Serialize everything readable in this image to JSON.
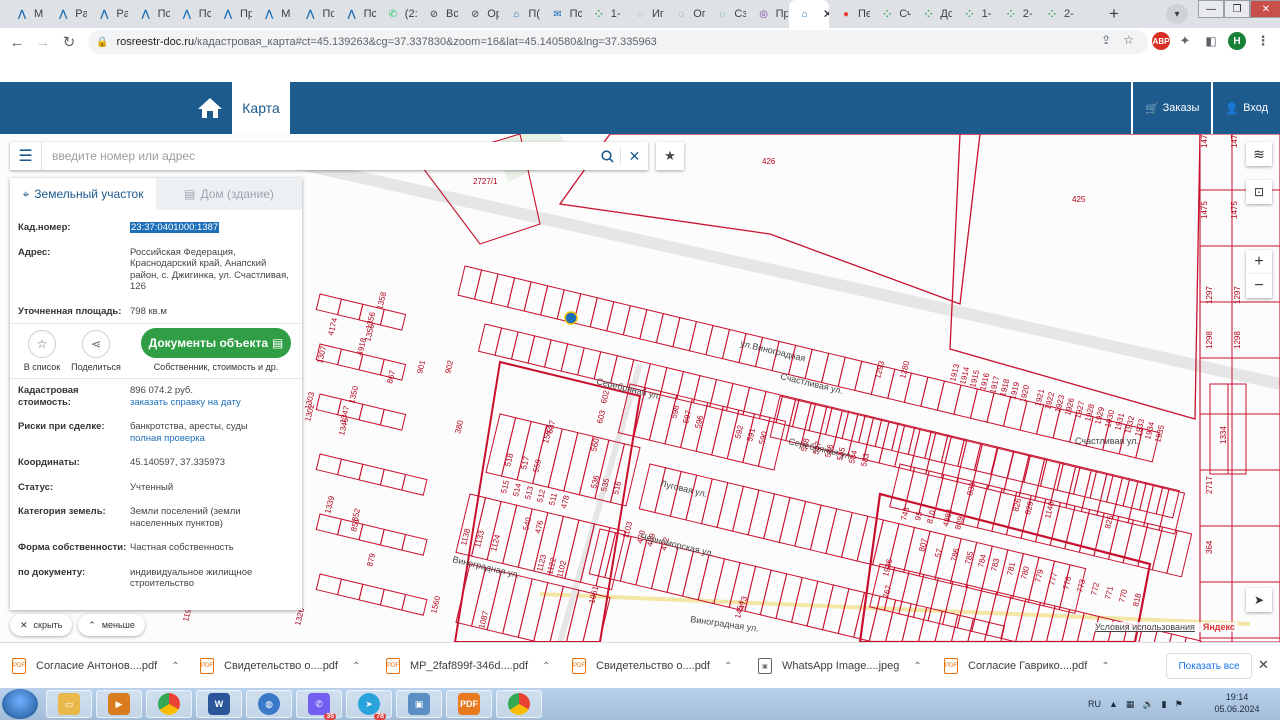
{
  "browser": {
    "tabs": [
      {
        "title": "M",
        "icon": "rr-logo-icon",
        "color": "#1d6fb8",
        "glyph": "⋀"
      },
      {
        "title": "Pa",
        "icon": "rr-logo-icon",
        "color": "#1d6fb8",
        "glyph": "⋀"
      },
      {
        "title": "Pa",
        "icon": "rr-logo-icon",
        "color": "#1d6fb8",
        "glyph": "⋀"
      },
      {
        "title": "Пс",
        "icon": "rr-logo-icon",
        "color": "#1d6fb8",
        "glyph": "⋀"
      },
      {
        "title": "Пс",
        "icon": "rr-logo-icon",
        "color": "#1d6fb8",
        "glyph": "⋀"
      },
      {
        "title": "Пр",
        "icon": "rr-logo-icon",
        "color": "#1d6fb8",
        "glyph": "⋀"
      },
      {
        "title": "M",
        "icon": "rr-logo-icon",
        "color": "#1d6fb8",
        "glyph": "⋀"
      },
      {
        "title": "Пс",
        "icon": "rr-logo-icon",
        "color": "#1d6fb8",
        "glyph": "⋀"
      },
      {
        "title": "Пс",
        "icon": "rr-logo-icon",
        "color": "#1d6fb8",
        "glyph": "⋀"
      },
      {
        "title": "(2:",
        "icon": "whatsapp-icon",
        "color": "#25d366",
        "glyph": "✆"
      },
      {
        "title": "Вс",
        "icon": "globe-icon",
        "color": "#5f6368",
        "glyph": "⊘"
      },
      {
        "title": "Ор",
        "icon": "globe-icon",
        "color": "#5f6368",
        "glyph": "⊘"
      },
      {
        "title": "П(",
        "icon": "home-icon",
        "color": "#1d6fb8",
        "glyph": "⌂"
      },
      {
        "title": "Пс",
        "icon": "mail-icon",
        "color": "#1d6fb8",
        "glyph": "✉"
      },
      {
        "title": "1-",
        "icon": "dots-icon",
        "color": "#34a853",
        "glyph": "⁘"
      },
      {
        "title": "Иг",
        "icon": "refresh-icon",
        "color": "#34a853",
        "glyph": "◌"
      },
      {
        "title": "Ог",
        "icon": "refresh-icon",
        "color": "#34a853",
        "glyph": "◌"
      },
      {
        "title": "Сз",
        "icon": "refresh-icon",
        "color": "#34a853",
        "glyph": "◌"
      },
      {
        "title": "Пр",
        "icon": "emblem-icon",
        "color": "#7b3fa0",
        "glyph": "◎"
      },
      {
        "title": "",
        "icon": "home-icon",
        "color": "#1d6fb8",
        "glyph": "⌂",
        "active": true
      },
      {
        "title": "Пє",
        "icon": "map-pin-icon",
        "color": "#ea4335",
        "glyph": "●"
      },
      {
        "title": "Сч",
        "icon": "dots-icon",
        "color": "#34a853",
        "glyph": "⁘"
      },
      {
        "title": "Дс",
        "icon": "dots-icon",
        "color": "#34a853",
        "glyph": "⁘"
      },
      {
        "title": "1-",
        "icon": "dots-icon",
        "color": "#34a853",
        "glyph": "⁘"
      },
      {
        "title": "2-",
        "icon": "dots-icon",
        "color": "#34a853",
        "glyph": "⁘"
      },
      {
        "title": "2-",
        "icon": "dots-icon",
        "color": "#34a853",
        "glyph": "⁘"
      }
    ],
    "url_host": "rosreestr-doc.ru",
    "url_path": "/кадастровая_карта#ct=45.139263&cg=37.337830&zoom=16&lat=45.140580&lng=37.335963",
    "profile_initial": "H",
    "abp_label": "ABP"
  },
  "site": {
    "nav_map": "Карта",
    "orders": "Заказы",
    "login": "Вход",
    "search_placeholder": "введите номер или адрес"
  },
  "panel": {
    "tab_land": "Земельный участок",
    "tab_house": "Дом (здание)",
    "kad_label": "Кад.номер:",
    "kad_value": "23:37:0401000:1387",
    "addr_label": "Адрес:",
    "addr_value": "Российская Федерация, Краснодарский край, Анапский район, с. Джигинка, ул. Счастливая, 126",
    "area_label": "Уточненная площадь:",
    "area_value": "798 кв.м",
    "act_list": "В список",
    "act_share": "Поделиться",
    "doc_button": "Документы объекта",
    "doc_sub": "Собственник, стоимость и др.",
    "cost_label": "Кадастровая стоимость:",
    "cost_value": "896 074.2 руб.",
    "cost_link": "заказать справку на дату",
    "risk_label": "Риски при сделке:",
    "risk_value": "банкротства, аресты, суды",
    "risk_link": "полная проверка",
    "coord_label": "Координаты:",
    "coord_value": "45.140597, 37.335973",
    "status_label": "Статус:",
    "status_value": "Учтенный",
    "cat_label": "Категория земель:",
    "cat_value": "Земли поселений (земли населенных пунктов)",
    "own_label": "Форма собственности:",
    "own_value": "Частная собственность",
    "doc_label": "по документу:",
    "doc_value": "индивидуальное жилищное строительство",
    "hide": "скрыть",
    "less": "меньше"
  },
  "map": {
    "attribution": "Условия использования",
    "yandex": "Яндекс",
    "streets": [
      "ул.Виноградная",
      "Счастливая ул.",
      "Серебряная ул.",
      "Серебряная ул.",
      "Счастливая ул.",
      "Виноградная ул.",
      "Виноградная ул.",
      "Черноморская ул.",
      "Луговая ул."
    ],
    "labels": [
      "426",
      "425",
      "2727/1",
      "1474",
      "1474",
      "1475",
      "1475",
      "1297",
      "1297",
      "1298",
      "1298",
      "1334",
      "2717",
      "364",
      "1358",
      "1356",
      "1355",
      "4174",
      "4918",
      "1307",
      "867",
      "1303",
      "1302",
      "1350",
      "1347",
      "1346",
      "901",
      "902",
      "380",
      "1293",
      "1280",
      "1339",
      "852",
      "851",
      "879",
      "1195",
      "1326",
      "603",
      "602",
      "598",
      "597",
      "596",
      "592",
      "591",
      "590",
      "588",
      "587",
      "586",
      "585",
      "584",
      "583",
      "1913",
      "1914",
      "1915",
      "1916",
      "1917",
      "1918",
      "1919",
      "1920",
      "1921",
      "1922",
      "1923",
      "1926",
      "1927",
      "1928",
      "1929",
      "1930",
      "1931",
      "1932",
      "1933",
      "1934",
      "1935",
      "1936",
      "767",
      "743",
      "95",
      "810",
      "4884",
      "809",
      "807",
      "57",
      "786",
      "785",
      "784",
      "783",
      "781",
      "780",
      "779",
      "777",
      "776",
      "773",
      "772",
      "771",
      "770",
      "818",
      "825",
      "826",
      "829",
      "833",
      "1140",
      "1138",
      "1133",
      "1124",
      "1123",
      "1122",
      "1102",
      "1103",
      "470",
      "469",
      "472",
      "473",
      "1061",
      "1087",
      "1454",
      "1560",
      "1562",
      "537",
      "536",
      "535",
      "516",
      "515",
      "514",
      "513",
      "512",
      "511",
      "478",
      "476",
      "540",
      "518",
      "517",
      "559",
      "560"
    ]
  },
  "downloads": {
    "items": [
      {
        "name": "Согласие Антонов....pdf",
        "type": "pdf"
      },
      {
        "name": "Свидетельство о....pdf",
        "type": "pdf"
      },
      {
        "name": "MP_2faf899f-346d....pdf",
        "type": "pdf"
      },
      {
        "name": "Свидетельство о....pdf",
        "type": "pdf"
      },
      {
        "name": "WhatsApp Image....jpeg",
        "type": "img"
      },
      {
        "name": "Согласие Гаврико....pdf",
        "type": "pdf"
      }
    ],
    "show_all": "Показать все"
  },
  "taskbar": {
    "lang": "RU",
    "time": "19:14",
    "date": "05.06.2024",
    "badge_viber": "35",
    "badge_telegram": "78"
  }
}
